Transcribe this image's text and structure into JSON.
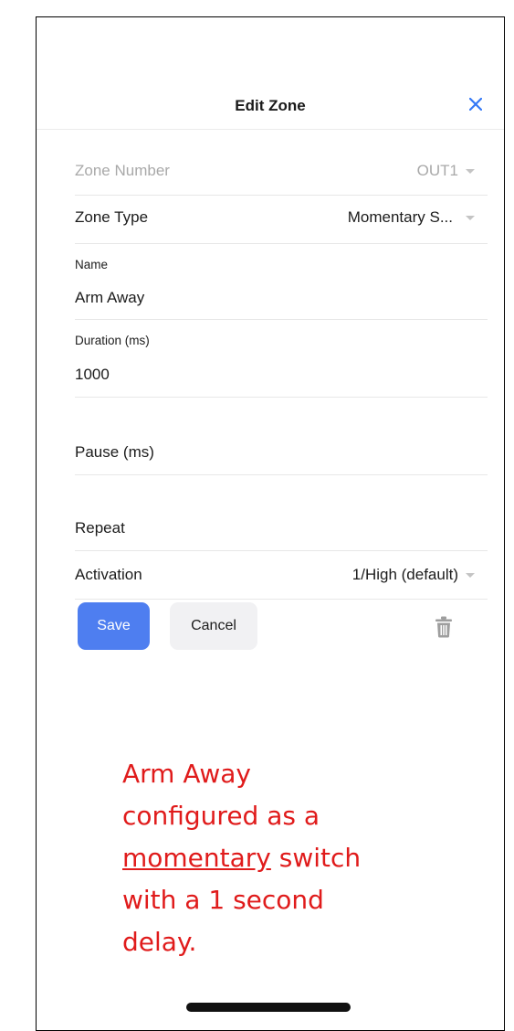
{
  "header": {
    "title": "Edit Zone",
    "close_icon": "close-icon",
    "accent": "#3478f6"
  },
  "fields": {
    "zone_number": {
      "label": "Zone Number",
      "value": "OUT1"
    },
    "zone_type": {
      "label": "Zone Type",
      "value": "Momentary S..."
    },
    "name": {
      "label": "Name",
      "value": "Arm Away"
    },
    "duration": {
      "label": "Duration (ms)",
      "value": "1000"
    },
    "pause": {
      "label": "Pause (ms)",
      "value": ""
    },
    "repeat": {
      "label": "Repeat",
      "value": ""
    },
    "activation": {
      "label": "Activation",
      "value": "1/High (default)"
    }
  },
  "actions": {
    "save_label": "Save",
    "cancel_label": "Cancel",
    "save_color": "#4e7ef0",
    "delete_icon": "trash-icon"
  },
  "annotation": {
    "line1": "Arm Away",
    "line2": "configured as a",
    "underlined": "momentary",
    "after_underlined": " switch",
    "line4": "with a 1 second",
    "line5": "delay.",
    "color": "#e01b1b"
  }
}
